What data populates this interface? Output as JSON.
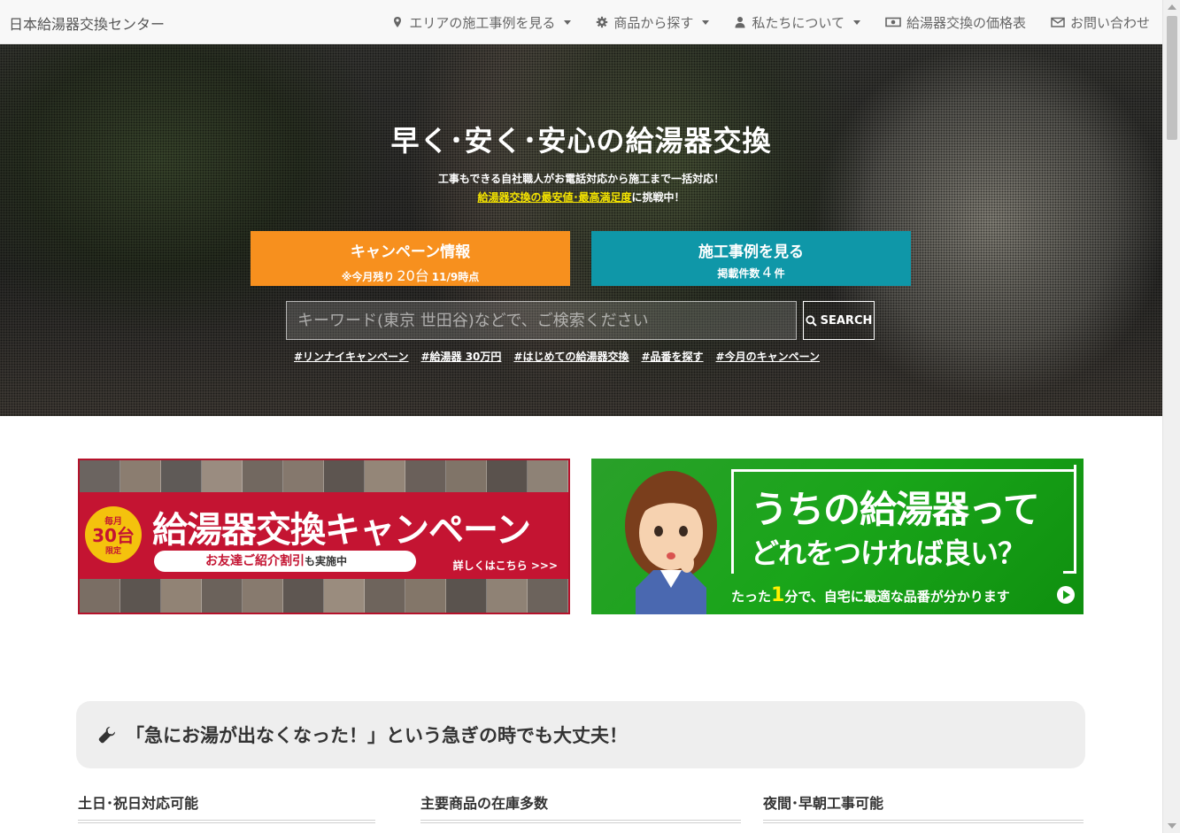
{
  "brand": "日本給湯器交換センター",
  "nav": {
    "items": [
      {
        "label": "エリアの施工事例を見る",
        "icon": "map-marker-icon",
        "dropdown": true
      },
      {
        "label": "商品から探す",
        "icon": "gear-icon",
        "dropdown": true
      },
      {
        "label": "私たちについて",
        "icon": "user-icon",
        "dropdown": true
      },
      {
        "label": "給湯器交換の価格表",
        "icon": "money-icon",
        "dropdown": false
      },
      {
        "label": "お問い合わせ",
        "icon": "envelope-icon",
        "dropdown": false
      }
    ]
  },
  "hero": {
    "title": "早く･安く･安心の給湯器交換",
    "sub1": "工事もできる自社職人がお電話対応から施工まで一括対応！",
    "sub2_highlight": "給湯器交換の最安値･最高満足度",
    "sub2_rest": "に挑戦中！",
    "campaign_button": {
      "title": "キャンペーン情報",
      "prefix": "※今月残り",
      "count": "20台",
      "suffix": "11/9時点"
    },
    "cases_button": {
      "title": "施工事例を見る",
      "prefix": "掲載件数",
      "count": "4",
      "suffix": "件"
    },
    "search": {
      "placeholder": "キーワード(東京 世田谷)などで、ご検索ください",
      "button_label": "SEARCH"
    },
    "tags": [
      "#リンナイキャンペーン",
      "#給湯器 30万円",
      "#はじめての給湯器交換",
      "#品番を探す",
      "#今月のキャンペーン"
    ]
  },
  "banners": {
    "campaign": {
      "badge_top": "毎月",
      "badge_mid": "30台",
      "badge_bot": "限定",
      "title": "給湯器交換キャンペーン",
      "pill_main": "お友達ご紹介割引",
      "pill_small": "も実施中",
      "more": "詳しくはこちら >>>"
    },
    "quiz": {
      "line1": "うちの給湯器って",
      "line2": "どれをつければ良い？",
      "foot_pre": "たった",
      "foot_num": "1",
      "foot_post": "分で、自宅に最適な品番が分かります"
    }
  },
  "emergency": {
    "title": "「急にお湯が出なくなった！」という急ぎの時でも大丈夫！"
  },
  "features": [
    "土日･祝日対応可能",
    "主要商品の在庫多数",
    "夜間･早朝工事可能"
  ],
  "colors": {
    "orange": "#f7901e",
    "teal": "#0f97a8",
    "campaign_red": "#c41432",
    "quiz_green": "#19a519",
    "highlight_yellow": "#f5e400"
  }
}
